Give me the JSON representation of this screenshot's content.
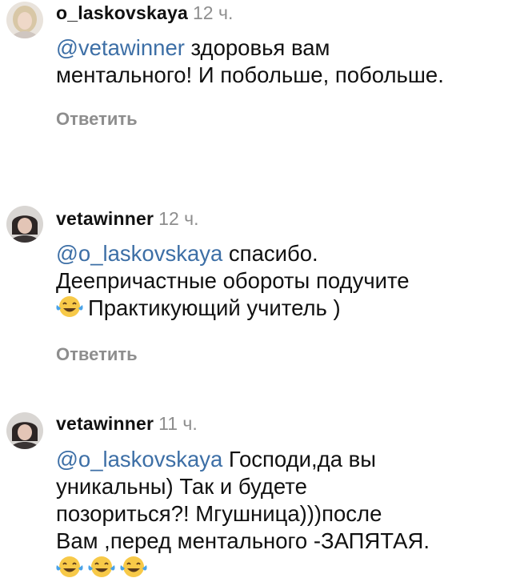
{
  "comments": [
    {
      "username": "o_laskovskaya",
      "time": "12 ч.",
      "mention": "@vetawinner",
      "text_first": " здоровья вам",
      "text_rest": "ментального! И побольше, побольше.",
      "reply_label": "Ответить",
      "avatar_icon": "profile-photo-light"
    },
    {
      "username": "vetawinner",
      "time": "12 ч.",
      "mention": "@o_laskovskaya",
      "text_first": " спасибо.",
      "text_line2": "Деепричастные обороты подучите",
      "emoji": "tears-of-joy",
      "text_line3": "Практикующий учитель )",
      "reply_label": "Ответить",
      "avatar_icon": "profile-photo-dark-hair"
    },
    {
      "username": "vetawinner",
      "time": "11 ч.",
      "mention": "@o_laskovskaya",
      "text_first": " Господи,да вы",
      "text_line2": "уникальны) Так и будете",
      "text_line3": "позориться?! Мгушница)))после",
      "text_line4": "Вам ,перед ментального -ЗАПЯТАЯ.",
      "emojis": [
        "tears-of-joy",
        "tears-of-joy",
        "tears-of-joy"
      ],
      "avatar_icon": "profile-photo-dark-hair"
    }
  ],
  "colors": {
    "mention": "#3d6fa6",
    "meta": "#8e8e8e",
    "text": "#111111"
  }
}
